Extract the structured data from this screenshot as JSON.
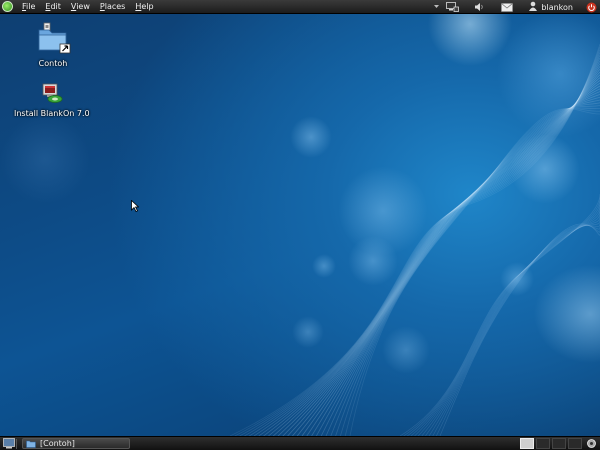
{
  "top_panel": {
    "menu": [
      {
        "label": "File",
        "underline": "F",
        "rest": "ile"
      },
      {
        "label": "Edit",
        "underline": "E",
        "rest": "dit"
      },
      {
        "label": "View",
        "underline": "V",
        "rest": "iew"
      },
      {
        "label": "Places",
        "underline": "P",
        "rest": "laces"
      },
      {
        "label": "Help",
        "underline": "H",
        "rest": "elp"
      }
    ],
    "tray": {
      "icons": [
        "network-icon",
        "volume-icon",
        "mail-icon",
        "user-icon",
        "power-icon"
      ],
      "user_name": "blankon"
    }
  },
  "desktop": {
    "icons": [
      {
        "label": "Contoh",
        "icon": "folder-icon"
      },
      {
        "label": "Install BlankOn 7.0",
        "icon": "installer-icon"
      }
    ]
  },
  "bottom_panel": {
    "taskbar": [
      {
        "label": "[Contoh]",
        "icon": "folder-icon"
      }
    ],
    "workspaces": 4,
    "active_workspace": 1
  },
  "colors": {
    "wallpaper_dark": "#0d4b86",
    "wallpaper_light": "#1f86c9",
    "panel": "#1c1c1c"
  }
}
